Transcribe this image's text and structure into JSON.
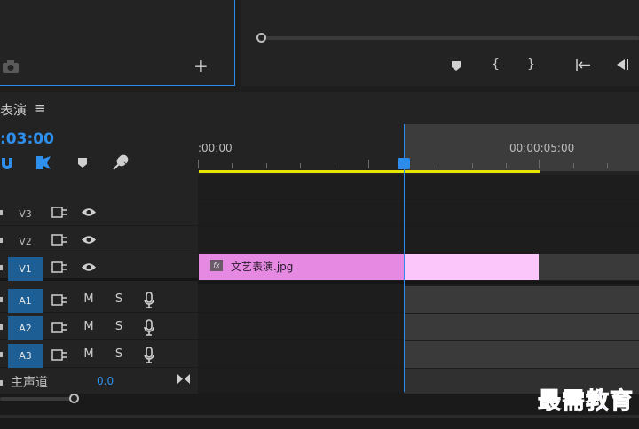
{
  "sequence": {
    "name": "表演",
    "timecode": ":03:00"
  },
  "ruler": {
    "label_start": ":00:00",
    "label_mid": "00:00:05:00"
  },
  "tracks": {
    "video": [
      {
        "label": "V3",
        "active": false
      },
      {
        "label": "V2",
        "active": false
      },
      {
        "label": "V1",
        "active": true
      }
    ],
    "audio": [
      {
        "label": "A1",
        "mute": "M",
        "solo": "S"
      },
      {
        "label": "A2",
        "mute": "M",
        "solo": "S"
      },
      {
        "label": "A3",
        "mute": "M",
        "solo": "S"
      }
    ],
    "master": {
      "label": "主声道",
      "value": "0.0"
    }
  },
  "clip": {
    "name": "文艺表演.jpg",
    "fx": "fx"
  },
  "icons": {
    "menu": "≡",
    "marker": "marker-icon",
    "in_point": "{",
    "out_point": "}",
    "go_to_in": "go-to-in-icon",
    "step_back": "step-back-icon",
    "add": "+",
    "camera": "camera-icon"
  },
  "watermark": "最需教育",
  "colors": {
    "accent": "#2d8ceb",
    "clip": "#e589e3",
    "clip_selected": "#fbc7fb",
    "work_area": "#e8e600"
  }
}
